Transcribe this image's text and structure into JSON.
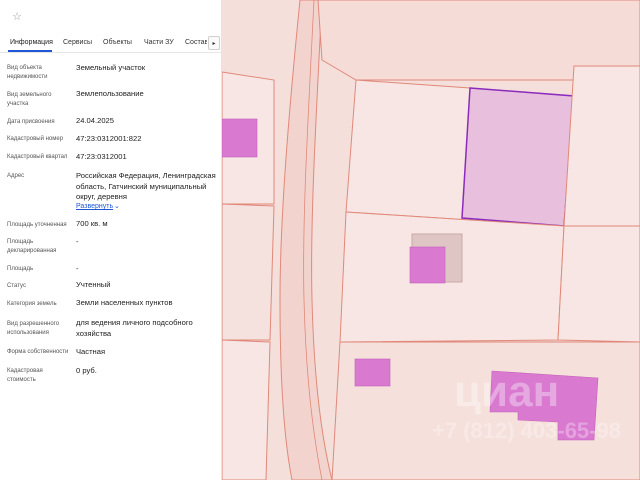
{
  "panel": {
    "favorite_icon": "star-outline-icon",
    "tabs": [
      {
        "label": "Информация"
      },
      {
        "label": "Сервисы"
      },
      {
        "label": "Объекты"
      },
      {
        "label": "Части ЗУ"
      },
      {
        "label": "Состав"
      }
    ],
    "tabs_next_icon": "chevron-right-icon",
    "tabs_next_glyph": "▸",
    "fields": {
      "object_type": {
        "label": "Вид объекта недвижимости",
        "value": "Земельный участок"
      },
      "land_type": {
        "label": "Вид земельного участка",
        "value": "Землепользование"
      },
      "assigned_date": {
        "label": "Дата присвоения",
        "value": "24.04.2025"
      },
      "cadastral_number": {
        "label": "Кадастровый номер",
        "value": "47:23:0312001:822"
      },
      "cadastral_quarter": {
        "label": "Кадастровый квартал",
        "value": "47:23:0312001"
      },
      "address": {
        "label": "Адрес",
        "value": "Российская Федерация, Ленинградская область, Гатчинский муниципальный округ, деревня"
      },
      "area_specified": {
        "label": "Площадь уточненная",
        "value": "700 кв. м"
      },
      "area_declared": {
        "label": "Площадь декларированная",
        "value": "-"
      },
      "area": {
        "label": "Площадь",
        "value": "-"
      },
      "status": {
        "label": "Статус",
        "value": "Учтенный"
      },
      "land_category": {
        "label": "Категория земель",
        "value": "Земли населенных пунктов"
      },
      "permitted_use": {
        "label": "Вид разрешенного использования",
        "value": "для ведения личного подсобного хозяйства"
      },
      "ownership_form": {
        "label": "Форма собственности",
        "value": "Частная"
      },
      "cadastral_value": {
        "label": "Кадастровая стоимость",
        "value": "0 руб."
      }
    },
    "expand_label": "Развернуть",
    "expand_icon": "chevron-down-icon",
    "expand_glyph": "⌄"
  },
  "map": {
    "colors": {
      "background": "#f5dfdb",
      "parcel_fill": "#f7e6e3",
      "parcel_border": "#e0897a",
      "road": "#f2d3cd",
      "building": "#d97ad0",
      "building_border": "#c45fbb",
      "selected_fill": "#e8bfdc",
      "selected_border": "#8a2bbd"
    },
    "watermark_line1": "циан",
    "watermark_line2": "+7 (812) 403-65-98"
  }
}
